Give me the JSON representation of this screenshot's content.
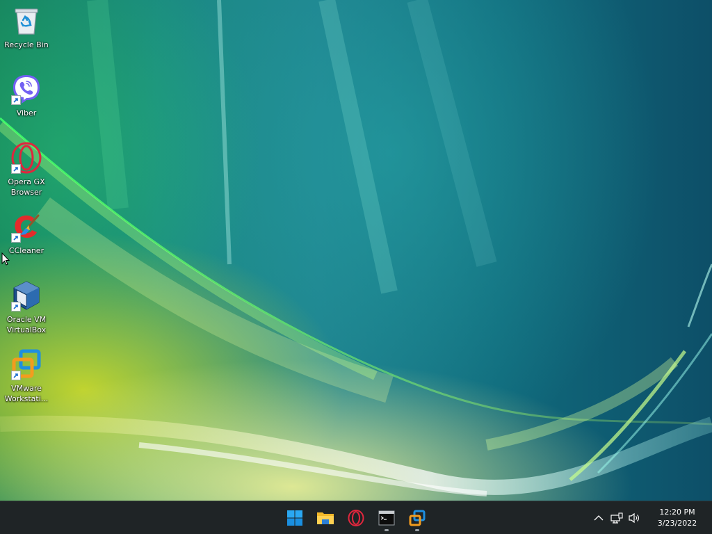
{
  "desktop": {
    "icons": [
      {
        "label": "Recycle Bin",
        "icon": "recycle-bin-icon"
      },
      {
        "label": "Viber",
        "icon": "viber-icon"
      },
      {
        "label": "Opera GX\nBrowser",
        "icon": "opera-gx-icon"
      },
      {
        "label": "CCleaner",
        "icon": "ccleaner-icon"
      },
      {
        "label": "Oracle VM\nVirtualBox",
        "icon": "virtualbox-icon"
      },
      {
        "label": "VMware\nWorkstati...",
        "icon": "vmware-icon"
      }
    ]
  },
  "taskbar": {
    "apps": [
      {
        "name": "Start",
        "icon": "windows-start-icon",
        "running": false
      },
      {
        "name": "File Explorer",
        "icon": "file-explorer-icon",
        "running": false
      },
      {
        "name": "Opera GX",
        "icon": "opera-gx-icon",
        "running": false
      },
      {
        "name": "Command Prompt",
        "icon": "terminal-icon",
        "running": true
      },
      {
        "name": "VMware Workstation",
        "icon": "vmware-icon",
        "running": true
      }
    ],
    "tray": {
      "icons": [
        "chevron-up-icon",
        "network-icon",
        "volume-icon"
      ],
      "time": "12:20 PM",
      "date": "3/23/2022"
    }
  },
  "colors": {
    "taskbar": "#1f2426",
    "accent": "#0078d4",
    "viber": "#7360f2",
    "opera": "#e0263d"
  }
}
